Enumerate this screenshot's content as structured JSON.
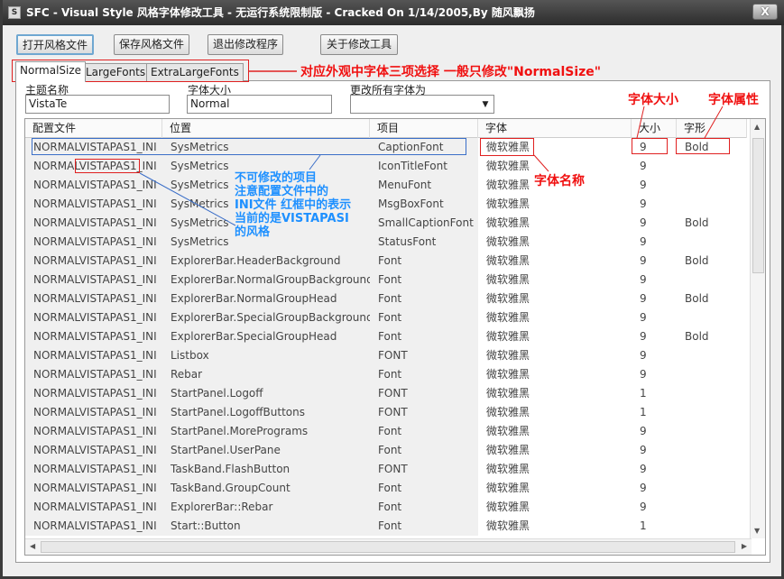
{
  "window": {
    "title": "SFC - Visual Style 风格字体修改工具 - 无运行系统限制版 - Cracked On 1/14/2005,By 随风飘扬",
    "close": "X",
    "icon": "app-icon"
  },
  "toolbar": {
    "open": "打开风格文件",
    "save": "保存风格文件",
    "exit": "退出修改程序",
    "about": "关于修改工具"
  },
  "tabs": [
    "NormalSize",
    "LargeFonts",
    "ExtraLargeFonts"
  ],
  "form": {
    "theme_label": "主题名称",
    "theme_value": "VistaTe",
    "size_label": "字体大小",
    "size_value": "Normal",
    "change_all_label": "更改所有字体为",
    "change_all_value": ""
  },
  "table": {
    "headers": [
      "配置文件",
      "位置",
      "项目",
      "字体",
      "大小",
      "字形"
    ],
    "rows": [
      [
        "NORMALVISTAPAS1_INI",
        "SysMetrics",
        "CaptionFont",
        "微软雅黑",
        "9",
        "Bold"
      ],
      [
        "NORMALVISTAPAS1_INI",
        "SysMetrics",
        "IconTitleFont",
        "微软雅黑",
        "9",
        ""
      ],
      [
        "NORMALVISTAPAS1_INI",
        "SysMetrics",
        "MenuFont",
        "微软雅黑",
        "9",
        ""
      ],
      [
        "NORMALVISTAPAS1_INI",
        "SysMetrics",
        "MsgBoxFont",
        "微软雅黑",
        "9",
        ""
      ],
      [
        "NORMALVISTAPAS1_INI",
        "SysMetrics",
        "SmallCaptionFont",
        "微软雅黑",
        "9",
        "Bold"
      ],
      [
        "NORMALVISTAPAS1_INI",
        "SysMetrics",
        "StatusFont",
        "微软雅黑",
        "9",
        ""
      ],
      [
        "NORMALVISTAPAS1_INI",
        "ExplorerBar.HeaderBackground",
        "Font",
        "微软雅黑",
        "9",
        "Bold"
      ],
      [
        "NORMALVISTAPAS1_INI",
        "ExplorerBar.NormalGroupBackground",
        "Font",
        "微软雅黑",
        "9",
        ""
      ],
      [
        "NORMALVISTAPAS1_INI",
        "ExplorerBar.NormalGroupHead",
        "Font",
        "微软雅黑",
        "9",
        "Bold"
      ],
      [
        "NORMALVISTAPAS1_INI",
        "ExplorerBar.SpecialGroupBackground",
        "Font",
        "微软雅黑",
        "9",
        ""
      ],
      [
        "NORMALVISTAPAS1_INI",
        "ExplorerBar.SpecialGroupHead",
        "Font",
        "微软雅黑",
        "9",
        "Bold"
      ],
      [
        "NORMALVISTAPAS1_INI",
        "Listbox",
        "FONT",
        "微软雅黑",
        "9",
        ""
      ],
      [
        "NORMALVISTAPAS1_INI",
        "Rebar",
        "Font",
        "微软雅黑",
        "9",
        ""
      ],
      [
        "NORMALVISTAPAS1_INI",
        "StartPanel.Logoff",
        "FONT",
        "微软雅黑",
        "1",
        ""
      ],
      [
        "NORMALVISTAPAS1_INI",
        "StartPanel.LogoffButtons",
        "FONT",
        "微软雅黑",
        "1",
        ""
      ],
      [
        "NORMALVISTAPAS1_INI",
        "StartPanel.MorePrograms",
        "Font",
        "微软雅黑",
        "9",
        ""
      ],
      [
        "NORMALVISTAPAS1_INI",
        "StartPanel.UserPane",
        "Font",
        "微软雅黑",
        "9",
        ""
      ],
      [
        "NORMALVISTAPAS1_INI",
        "TaskBand.FlashButton",
        "FONT",
        "微软雅黑",
        "9",
        ""
      ],
      [
        "NORMALVISTAPAS1_INI",
        "TaskBand.GroupCount",
        "Font",
        "微软雅黑",
        "9",
        ""
      ],
      [
        "NORMALVISTAPAS1_INI",
        "ExplorerBar::Rebar",
        "Font",
        "微软雅黑",
        "9",
        ""
      ],
      [
        "NORMALVISTAPAS1_INI",
        "Start::Button",
        "Font",
        "微软雅黑",
        "1",
        ""
      ]
    ]
  },
  "annotations": {
    "tabs_note": "对应外观中字体三项选择 一般只修改\"NormalSize\"",
    "size_note": "字体大小",
    "style_note": "字体属性",
    "font_name_note": "字体名称",
    "ini_note": [
      "不可修改的项目",
      "注意配置文件中的",
      "INI文件 红框中的表示",
      "当前的是VISTAPASI",
      "的风格"
    ]
  },
  "colors": {
    "annotation_red": "#f01010",
    "annotation_blue": "#1e90ff"
  }
}
